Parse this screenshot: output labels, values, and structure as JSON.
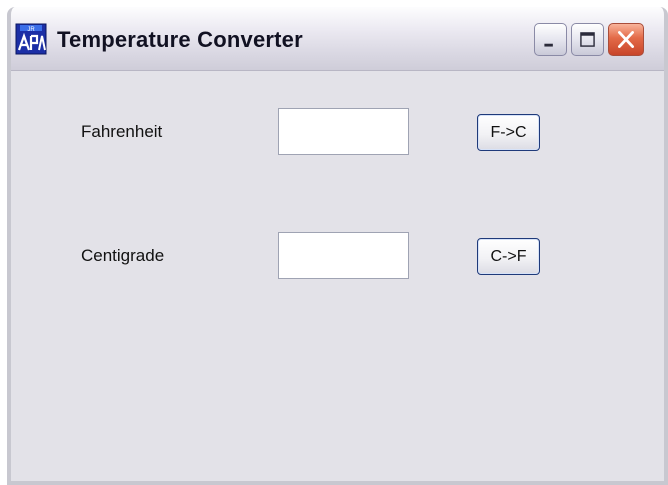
{
  "window": {
    "title": "Temperature Converter",
    "icon": "java-app-icon",
    "controls": [
      "minimize",
      "maximize",
      "close"
    ]
  },
  "form": {
    "fahrenheit_label": "Fahrenheit",
    "fahrenheit_value": "",
    "f_to_c_label": "F->C",
    "centigrade_label": "Centigrade",
    "centigrade_value": "",
    "c_to_f_label": "C->F"
  },
  "colors": {
    "client_background": "#e3e2e8",
    "close_button": "#e36a48",
    "button_border": "#1f3a7a"
  }
}
